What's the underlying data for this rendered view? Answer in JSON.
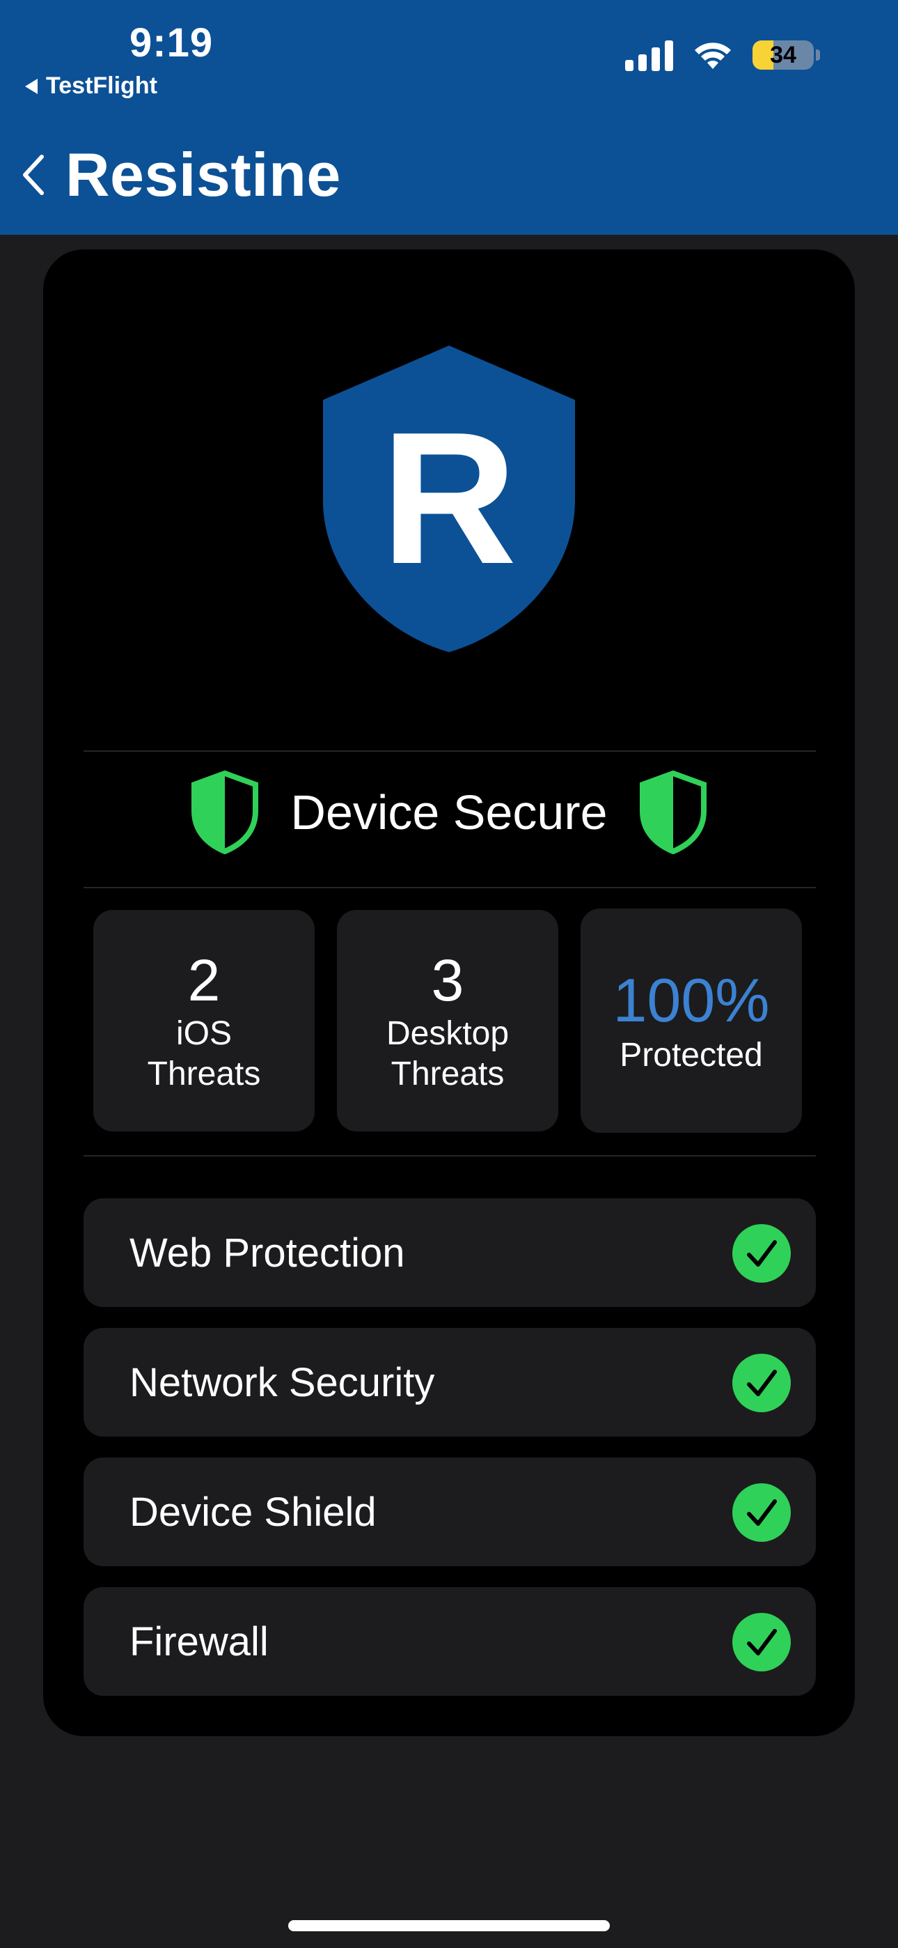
{
  "status_bar": {
    "time": "9:19",
    "back_app": "TestFlight",
    "battery_level": "34"
  },
  "nav": {
    "title": "Resistine"
  },
  "logo": {
    "letter": "R",
    "color": "#0c5196"
  },
  "status": {
    "label": "Device Secure",
    "color": "#30d158"
  },
  "stats": [
    {
      "value": "2",
      "label": "iOS\nThreats"
    },
    {
      "value": "3",
      "label": "Desktop\nThreats"
    },
    {
      "value": "100%",
      "label": "Protected"
    }
  ],
  "features": [
    {
      "label": "Web Protection",
      "enabled": true
    },
    {
      "label": "Network Security",
      "enabled": true
    },
    {
      "label": "Device Shield",
      "enabled": true
    },
    {
      "label": "Firewall",
      "enabled": true
    }
  ],
  "colors": {
    "header": "#0c5196",
    "accent_green": "#30d158",
    "accent_blue": "#3c82d3",
    "background": "#1c1c1e",
    "card": "#000000"
  }
}
